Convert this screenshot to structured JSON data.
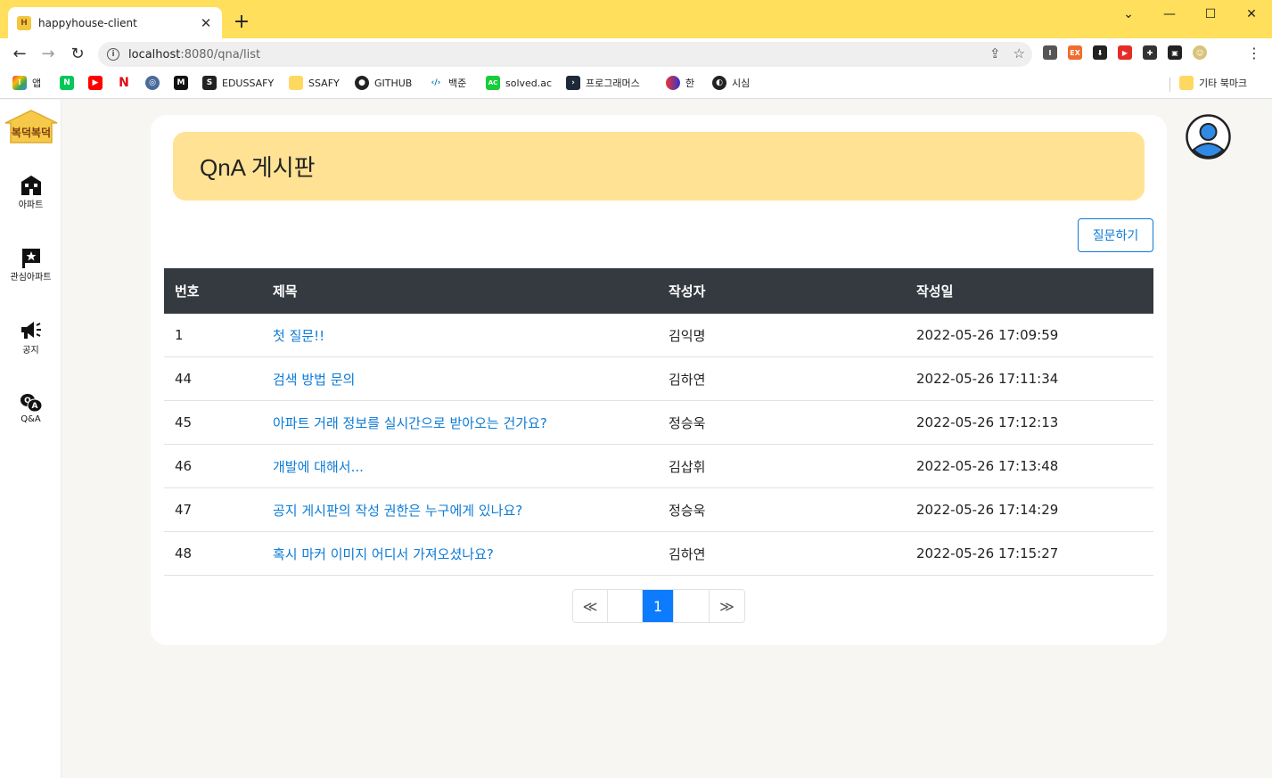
{
  "browser": {
    "tab_title": "happyhouse-client",
    "tab_favicon_text": "H",
    "url_host": "localhost",
    "url_path": ":8080/qna/list",
    "bookmarks": [
      "앱",
      "EDUSSAFY",
      "SSAFY",
      "GITHUB",
      "백준",
      "solved.ac",
      "프로그래머스",
      "한",
      "시심"
    ],
    "other_bookmarks": "기타 북마크"
  },
  "sidebar": {
    "logo_text": "복덕복덕",
    "items": [
      {
        "label": "아파트",
        "icon": "building-icon"
      },
      {
        "label": "관심아파트",
        "icon": "star-flag-icon"
      },
      {
        "label": "공지",
        "icon": "megaphone-icon"
      },
      {
        "label": "Q&A",
        "icon": "qa-chat-icon"
      }
    ]
  },
  "page": {
    "title": "QnA 게시판",
    "ask_button": "질문하기"
  },
  "table": {
    "headers": [
      "번호",
      "제목",
      "작성자",
      "작성일"
    ],
    "rows": [
      {
        "no": "1",
        "title": "첫 질문!!",
        "author": "김익명",
        "date": "2022-05-26 17:09:59"
      },
      {
        "no": "44",
        "title": "검색 방법 문의",
        "author": "김하연",
        "date": "2022-05-26 17:11:34"
      },
      {
        "no": "45",
        "title": "아파트 거래 정보를 실시간으로 받아오는 건가요?",
        "author": "정승욱",
        "date": "2022-05-26 17:12:13"
      },
      {
        "no": "46",
        "title": "개발에 대해서...",
        "author": "김삽휘",
        "date": "2022-05-26 17:13:48"
      },
      {
        "no": "47",
        "title": "공지 게시판의 작성 권한은 누구에게 있나요?",
        "author": "정승욱",
        "date": "2022-05-26 17:14:29"
      },
      {
        "no": "48",
        "title": "혹시 마커 이미지 어디서 가져오셨나요?",
        "author": "김하연",
        "date": "2022-05-26 17:15:27"
      }
    ]
  },
  "pagination": {
    "first": "≪",
    "current": "1",
    "last": "≫"
  },
  "colors": {
    "accent_yellow": "#ffdf5c",
    "banner": "#ffe294",
    "link_blue": "#0c7bd6",
    "header_dark": "#343a40",
    "active_page": "#0c7bfe"
  }
}
